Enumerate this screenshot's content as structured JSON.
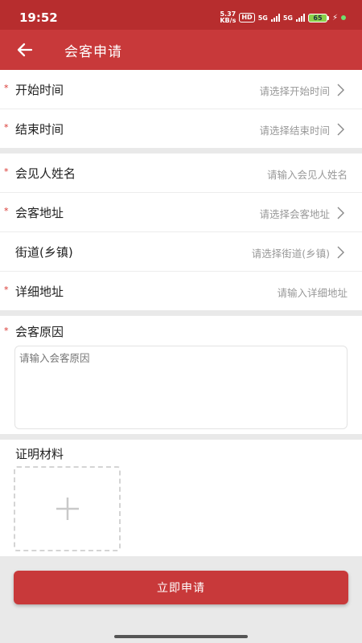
{
  "status_bar": {
    "time": "19:52",
    "net_speed_value": "5.37",
    "net_speed_unit": "KB/s",
    "hd": "HD",
    "sim1": "5G",
    "sim2": "5G",
    "battery_level": "65"
  },
  "header": {
    "title": "会客申请",
    "back_icon": "arrow-left-icon"
  },
  "form": {
    "time_section": [
      {
        "label": "开始时间",
        "value": "请选择开始时间",
        "required": true,
        "has_arrow": true
      },
      {
        "label": "结束时间",
        "value": "请选择结束时间",
        "required": true,
        "has_arrow": true
      }
    ],
    "visit_section": [
      {
        "label": "会见人姓名",
        "value": "请输入会见人姓名",
        "required": true,
        "has_arrow": false
      },
      {
        "label": "会客地址",
        "value": "请选择会客地址",
        "required": true,
        "has_arrow": true
      },
      {
        "label": "街道(乡镇)",
        "value": "请选择街道(乡镇)",
        "required": false,
        "has_arrow": true
      },
      {
        "label": "详细地址",
        "value": "请输入详细地址",
        "required": true,
        "has_arrow": false
      }
    ],
    "reason": {
      "label": "会客原因",
      "placeholder": "请输入会客原因",
      "required": true
    },
    "attachment": {
      "label": "证明材料",
      "add_icon": "plus-icon"
    },
    "required_marker": "*"
  },
  "actions": {
    "submit_label": "立即申请"
  },
  "colors": {
    "brand": "#c8393a",
    "status_bar": "#b72d2e",
    "required": "#d8342f",
    "placeholder": "#999999",
    "background": "#e9e9e9"
  }
}
